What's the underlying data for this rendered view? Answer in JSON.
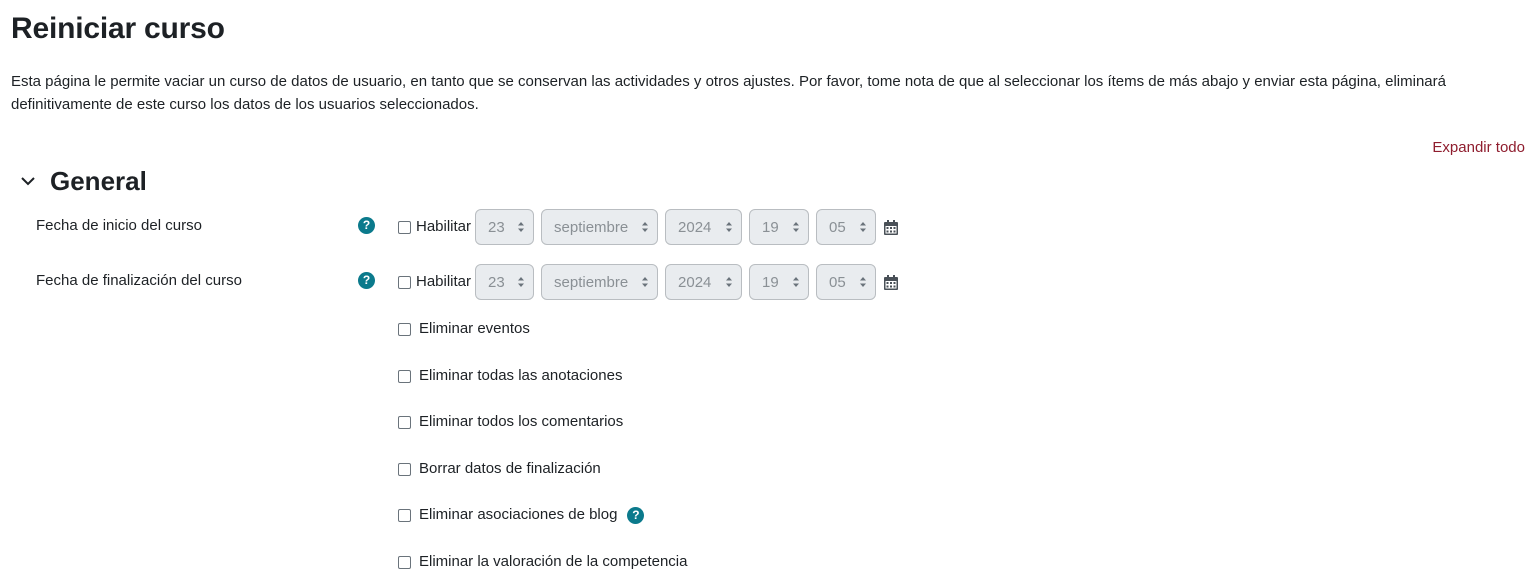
{
  "page": {
    "title": "Reiniciar curso",
    "intro": "Esta página le permite vaciar un curso de datos de usuario, en tanto que se conservan las actividades y otros ajustes. Por favor, tome nota de que al seleccionar los ítems de más abajo y enviar esta página, eliminará definitivamente de este curso los datos de los usuarios seleccionados.",
    "expand_all": "Expandir todo"
  },
  "section": {
    "title": "General",
    "icon": "chevron-down-icon"
  },
  "colors": {
    "link": "#8f1d2e",
    "help_icon": "#0b7a8c",
    "text": "#1d2125",
    "disabled_select_bg": "#e9ecef",
    "disabled_select_text": "#8a9095"
  },
  "fields": {
    "start_date": {
      "label": "Fecha de inicio del curso",
      "enable_label": "Habilitar",
      "enabled": false,
      "day": "23",
      "month": "septiembre",
      "year": "2024",
      "hour": "19",
      "minute": "05"
    },
    "end_date": {
      "label": "Fecha de finalización del curso",
      "enable_label": "Habilitar",
      "enabled": false,
      "day": "23",
      "month": "septiembre",
      "year": "2024",
      "hour": "19",
      "minute": "05"
    }
  },
  "help_icon_glyph": "?",
  "options": [
    {
      "label": "Eliminar eventos",
      "checked": false
    },
    {
      "label": "Eliminar todas las anotaciones",
      "checked": false
    },
    {
      "label": "Eliminar todos los comentarios",
      "checked": false
    },
    {
      "label": "Borrar datos de finalización",
      "checked": false
    },
    {
      "label": "Eliminar asociaciones de blog",
      "checked": false,
      "has_help": true
    },
    {
      "label": "Eliminar la valoración de la competencia",
      "checked": false
    }
  ]
}
